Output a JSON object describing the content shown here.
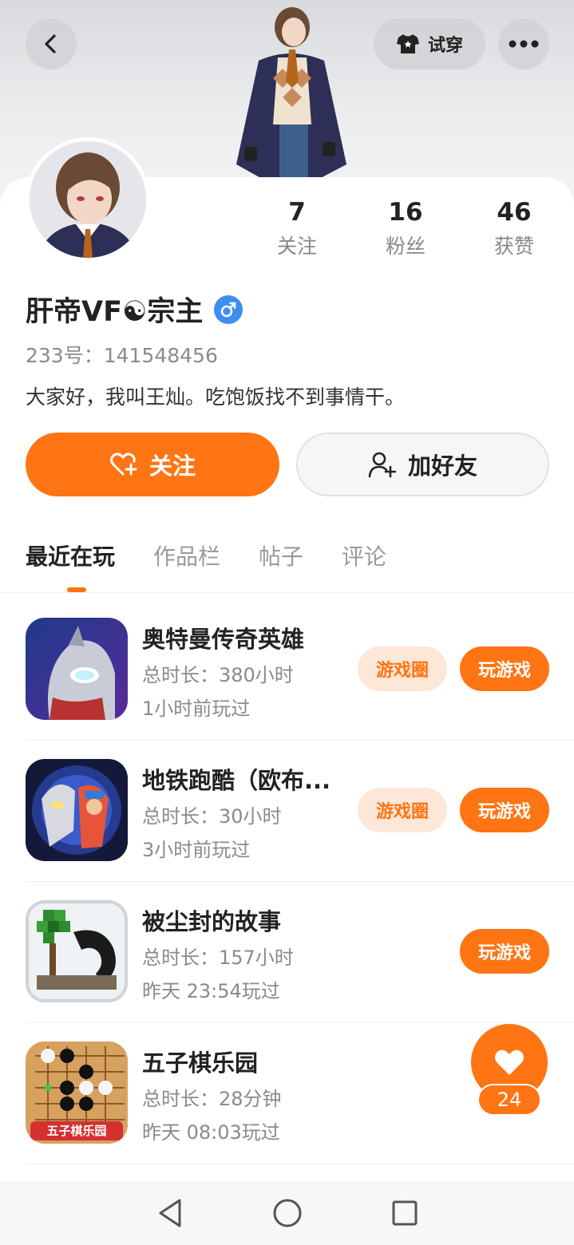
{
  "header": {
    "try_on_label": "试穿"
  },
  "profile": {
    "stats": [
      {
        "value": "7",
        "label": "关注"
      },
      {
        "value": "16",
        "label": "粉丝"
      },
      {
        "value": "46",
        "label": "获赞"
      }
    ],
    "name": "肝帝VF☯宗主",
    "uid": "233号：141548456",
    "bio": "大家好，我叫王灿。吃饱饭找不到事情干。"
  },
  "actions": {
    "follow_label": "关注",
    "add_friend_label": "加好友"
  },
  "tabs": [
    {
      "label": "最近在玩",
      "active": true
    },
    {
      "label": "作品栏",
      "active": false
    },
    {
      "label": "帖子",
      "active": false
    },
    {
      "label": "评论",
      "active": false
    }
  ],
  "games": [
    {
      "name": "奥特曼传奇英雄",
      "playtime": "总时长：380小时",
      "last_played": "1小时前玩过",
      "circle_label": "游戏圈",
      "play_label": "玩游戏"
    },
    {
      "name": "地铁跑酷（欧布...",
      "playtime": "总时长：30小时",
      "last_played": "3小时前玩过",
      "circle_label": "游戏圈",
      "play_label": "玩游戏"
    },
    {
      "name": "被尘封的故事",
      "playtime": "总时长：157小时",
      "last_played": "昨天 23:54玩过",
      "play_label": "玩游戏"
    },
    {
      "name": "五子棋乐园",
      "playtime": "总时长：28分钟",
      "last_played": "昨天 08:03玩过",
      "icon_caption": "五子棋乐园"
    }
  ],
  "like_fab": {
    "count": "24"
  },
  "colors": {
    "accent": "#ff7413",
    "accent_light": "#fde7d8",
    "gender_blue": "#3d8ef0"
  }
}
